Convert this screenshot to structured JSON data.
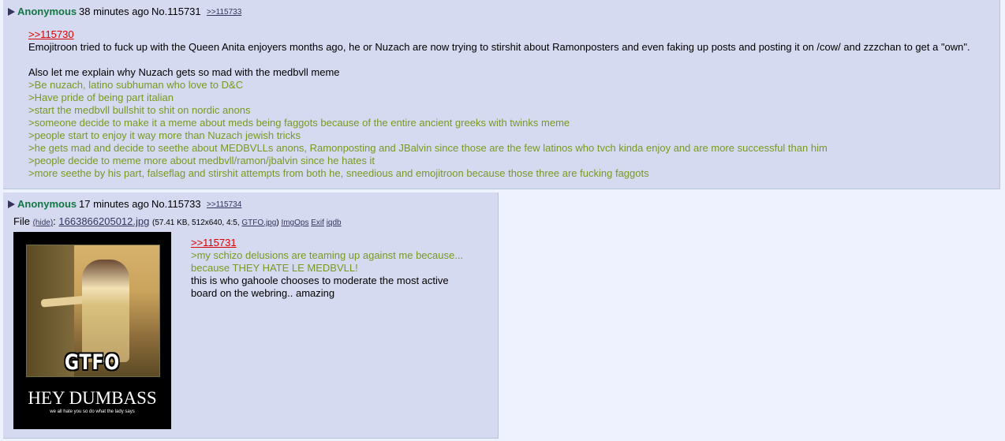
{
  "post1": {
    "name": "Anonymous",
    "time": "38 minutes ago",
    "number": "No.115731",
    "backlink": ">>115733",
    "quote_link": ">>115730",
    "lines": [
      "Emojitroon tried to fuck up with the Queen Anita enjoyers months ago, he or Nuzach are now trying to stirshit about Ramonposters and even faking up posts and posting it on /cow/ and zzzchan to get a \"own\".",
      "",
      "Also let me explain why Nuzach gets so mad with the medbvll meme"
    ],
    "greentext": [
      ">Be nuzach, latino subhuman who love to D&C",
      ">Have pride of being part italian",
      ">start the medbvll bullshit to shit on nordic anons",
      ">someone decide to make it a meme about meds being faggots because of the entire ancient greeks with twinks meme",
      ">people start to enjoy it way more than Nuzach jewish tricks",
      ">he gets mad and decide to seethe about MEDBVLLs anons, Ramonposting and JBalvin since those are the few latinos who tvch kinda enjoy and are more successful than him",
      ">people decide to meme more about medbvll/ramon/jbalvin since he hates it",
      ">more seethe by his part, falseflag and stirshit attempts from both he, sneedious and emojitroon because those three are fucking faggots"
    ]
  },
  "post2": {
    "name": "Anonymous",
    "time": "17 minutes ago",
    "number": "No.115733",
    "backlink": ">>115734",
    "file": {
      "prefix": "File",
      "hide": "(hide)",
      "colon": ":",
      "filename": "1663866205012.jpg",
      "info_pre": "(57.41 KB, 512x640, 4:5, ",
      "orig": "GTFO.jpg",
      "info_post": ")",
      "imgops": "ImgOps",
      "exif": "Exif",
      "iqdb": "iqdb"
    },
    "thumb": {
      "big": "GTFO",
      "title": "HEY DUMBASS",
      "caption": "we all hate you so do what the lady says"
    },
    "quote_link": ">>115731",
    "greentext": [
      ">my schizo delusions are teaming up against me because...",
      "because THEY HATE LE MEDBVLL!"
    ],
    "lines": [
      "this is who gahoole chooses to moderate the most active",
      "board on the webring.. amazing"
    ]
  }
}
